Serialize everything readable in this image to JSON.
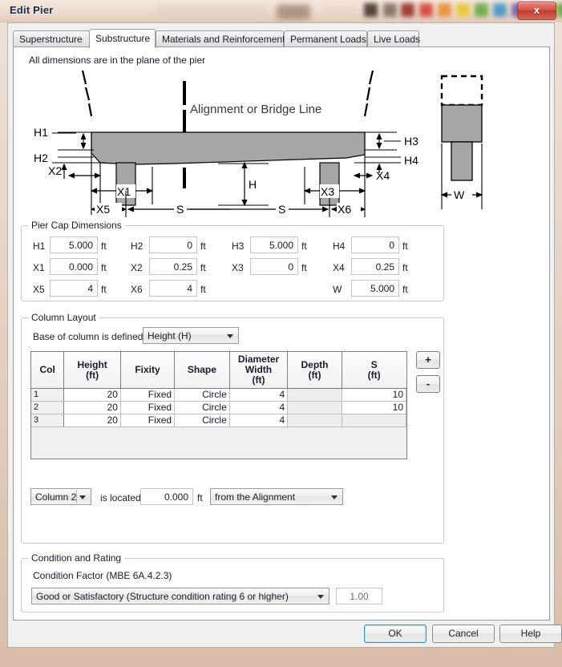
{
  "window": {
    "title": "Edit Pier",
    "close_label": "x"
  },
  "tabs": [
    {
      "label": "Superstructure",
      "active": false
    },
    {
      "label": "Substructure",
      "active": true
    },
    {
      "label": "Materials and Reinforcement",
      "active": false
    },
    {
      "label": "Permanent Loads",
      "active": false
    },
    {
      "label": "Live Loads",
      "active": false
    }
  ],
  "panel": {
    "hint": "All dimensions are in the plane of the pier"
  },
  "diagram": {
    "alignment_label": "Alignment or Bridge Line",
    "labels": {
      "h1": "H1",
      "h2": "H2",
      "h3": "H3",
      "h4": "H4",
      "x1": "X1",
      "x2": "X2",
      "x3": "X3",
      "x4": "X4",
      "x5": "X5",
      "x6": "X6",
      "s_left": "S",
      "s_right": "S",
      "h": "H",
      "w": "W"
    },
    "fill_color": "#a6a6a6",
    "line_color": "#000000"
  },
  "pier_cap": {
    "title": "Pier Cap Dimensions",
    "unit": "ft",
    "fields": [
      {
        "label": "H1",
        "value": "5.000"
      },
      {
        "label": "H2",
        "value": "0"
      },
      {
        "label": "H3",
        "value": "5.000"
      },
      {
        "label": "H4",
        "value": "0"
      },
      {
        "label": "X1",
        "value": "0.000"
      },
      {
        "label": "X2",
        "value": "0.25"
      },
      {
        "label": "X3",
        "value": "0"
      },
      {
        "label": "X4",
        "value": "0.25"
      },
      {
        "label": "X5",
        "value": "4"
      },
      {
        "label": "X6",
        "value": "4"
      },
      {
        "label": "W",
        "value": "5.000"
      }
    ]
  },
  "column_layout": {
    "title": "Column Layout",
    "base_label": "Base of column is defined by",
    "base_value": "Height (H)",
    "add_label": "+",
    "remove_label": "-",
    "columns": [
      "Col",
      "Height\n(ft)",
      "Fixity",
      "Shape",
      "Diameter\nWidth\n(ft)",
      "Depth\n(ft)",
      "S\n(ft)"
    ],
    "headers": [
      {
        "l1": "Col",
        "l2": "",
        "l3": ""
      },
      {
        "l1": "Height",
        "l2": "(ft)",
        "l3": ""
      },
      {
        "l1": "Fixity",
        "l2": "",
        "l3": ""
      },
      {
        "l1": "Shape",
        "l2": "",
        "l3": ""
      },
      {
        "l1": "Diameter",
        "l2": "Width",
        "l3": "(ft)"
      },
      {
        "l1": "Depth",
        "l2": "(ft)",
        "l3": ""
      },
      {
        "l1": "S",
        "l2": "(ft)",
        "l3": ""
      }
    ],
    "rows": [
      {
        "col": "1",
        "height": "20",
        "fixity": "Fixed",
        "shape": "Circle",
        "diameter": "4",
        "depth": "",
        "s": "10"
      },
      {
        "col": "2",
        "height": "20",
        "fixity": "Fixed",
        "shape": "Circle",
        "diameter": "4",
        "depth": "",
        "s": "10"
      },
      {
        "col": "3",
        "height": "20",
        "fixity": "Fixed",
        "shape": "Circle",
        "diameter": "4",
        "depth": "",
        "s": ""
      }
    ],
    "locator": {
      "column_select": "Column 2",
      "is_located_label": "is located",
      "distance": "0.000",
      "unit": "ft",
      "reference": "from the Alignment"
    }
  },
  "condition": {
    "title": "Condition and Rating",
    "factor_label": "Condition Factor (MBE 6A.4.2.3)",
    "factor_value": "Good or Satisfactory (Structure condition rating 6 or higher)",
    "factor_number": "1.00"
  },
  "footer": {
    "ok": "OK",
    "cancel": "Cancel",
    "help": "Help"
  }
}
